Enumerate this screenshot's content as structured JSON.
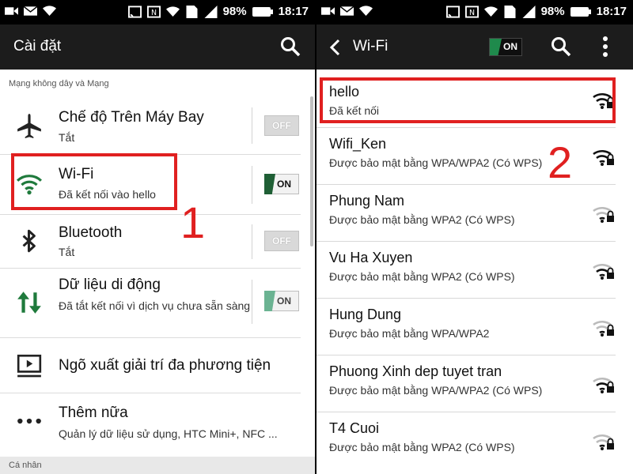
{
  "status_bar": {
    "battery": "98%",
    "time": "18:17"
  },
  "left_screen": {
    "title": "Cài đặt",
    "section_wireless": "Mạng không dây và Mạng",
    "items": [
      {
        "icon": "airplane-icon",
        "primary": "Chế độ Trên Máy Bay",
        "secondary": "Tắt",
        "toggle": "OFF"
      },
      {
        "icon": "wifi-icon",
        "primary": "Wi-Fi",
        "secondary": "Đã kết nối vào hello",
        "toggle": "ON"
      },
      {
        "icon": "bluetooth-icon",
        "primary": "Bluetooth",
        "secondary": "Tắt",
        "toggle": "OFF"
      },
      {
        "icon": "mobile-data-icon",
        "primary": "Dữ liệu di động",
        "secondary": "Đã tắt kết nối vì dịch vụ chưa sẵn sàng",
        "toggle": "ON"
      },
      {
        "icon": "media-output-icon",
        "primary": "Ngõ xuất giải trí đa phương tiện"
      },
      {
        "icon": "more-icon",
        "primary": "Thêm nữa",
        "secondary": "Quản lý dữ liệu sử dụng, HTC Mini+, NFC ..."
      }
    ],
    "section_personal": "Cá nhân",
    "annotation_number": "1"
  },
  "right_screen": {
    "title": "Wi-Fi",
    "master_toggle": "ON",
    "annotation_number": "2",
    "networks": [
      {
        "name": "hello",
        "status": "Đã kết nối",
        "signal": "strong"
      },
      {
        "name": "Wifi_Ken",
        "status": "Được bảo mật bằng WPA/WPA2 (Có WPS)",
        "signal": "strong"
      },
      {
        "name": "Phung Nam",
        "status": "Được bảo mật bằng WPA2 (Có WPS)",
        "signal": "weak"
      },
      {
        "name": "Vu Ha Xuyen",
        "status": "Được bảo mật bằng WPA2 (Có WPS)",
        "signal": "medium"
      },
      {
        "name": "Hung Dung",
        "status": "Được bảo mật bằng WPA/WPA2",
        "signal": "weak"
      },
      {
        "name": "Phuong Xinh dep tuyet tran",
        "status": "Được bảo mật bằng WPA/WPA2 (Có WPS)",
        "signal": "medium"
      },
      {
        "name": "T4 Cuoi",
        "status": "Được bảo mật bằng WPA2 (Có WPS)",
        "signal": "weak"
      }
    ]
  },
  "colors": {
    "annotation_red": "#e02020",
    "toggle_on_green": "#1f5f35"
  }
}
